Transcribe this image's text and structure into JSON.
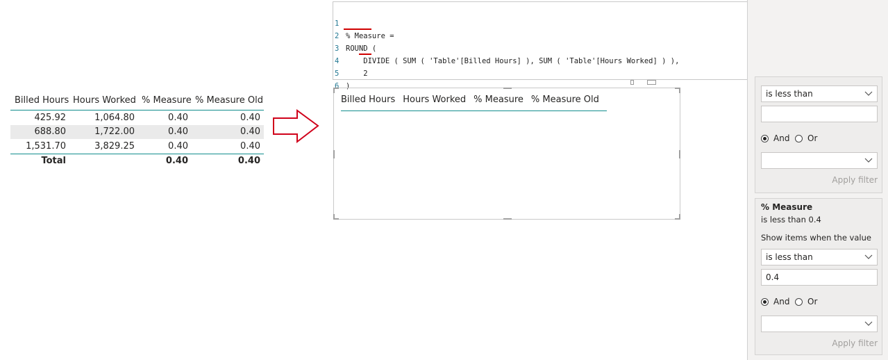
{
  "left_table": {
    "headers": [
      "Billed Hours",
      "Hours Worked",
      "% Measure",
      "% Measure Old"
    ],
    "rows": [
      [
        "425.92",
        "1,064.80",
        "0.40",
        "0.40"
      ],
      [
        "688.80",
        "1,722.00",
        "0.40",
        "0.40"
      ],
      [
        "1,531.70",
        "3,829.25",
        "0.40",
        "0.40"
      ]
    ],
    "total": [
      "Total",
      "",
      "0.40",
      "0.40"
    ]
  },
  "editor": {
    "lines": [
      {
        "n": "1",
        "text": "% Measure ="
      },
      {
        "n": "2",
        "text": "ROUND ("
      },
      {
        "n": "3",
        "text": "    DIVIDE ( SUM ( 'Table'[Billed Hours] ), SUM ( 'Table'[Hours Worked] ) ),"
      },
      {
        "n": "4",
        "text": "    2"
      },
      {
        "n": "5",
        "text": ")"
      },
      {
        "n": "6",
        "text": ""
      }
    ],
    "chevron": "chevron-down-icon",
    "minimize": "minimize-icon"
  },
  "visual": {
    "headers": [
      "Billed Hours",
      "Hours Worked",
      "% Measure",
      "% Measure Old"
    ]
  },
  "filter_pane": {
    "card1": {
      "operator": "is less than",
      "value": "",
      "and_label": "And",
      "or_label": "Or",
      "operator2": "",
      "apply": "Apply filter"
    },
    "card2": {
      "title": "% Measure",
      "summary": "is less than 0.4",
      "show_items": "Show items when the value",
      "operator": "is less than",
      "value": "0.4",
      "and_label": "And",
      "or_label": "Or",
      "operator2": "",
      "apply": "Apply filter"
    }
  },
  "colors": {
    "accent": "#118d8d",
    "arrow": "#d0021b",
    "underline": "#d00000"
  }
}
